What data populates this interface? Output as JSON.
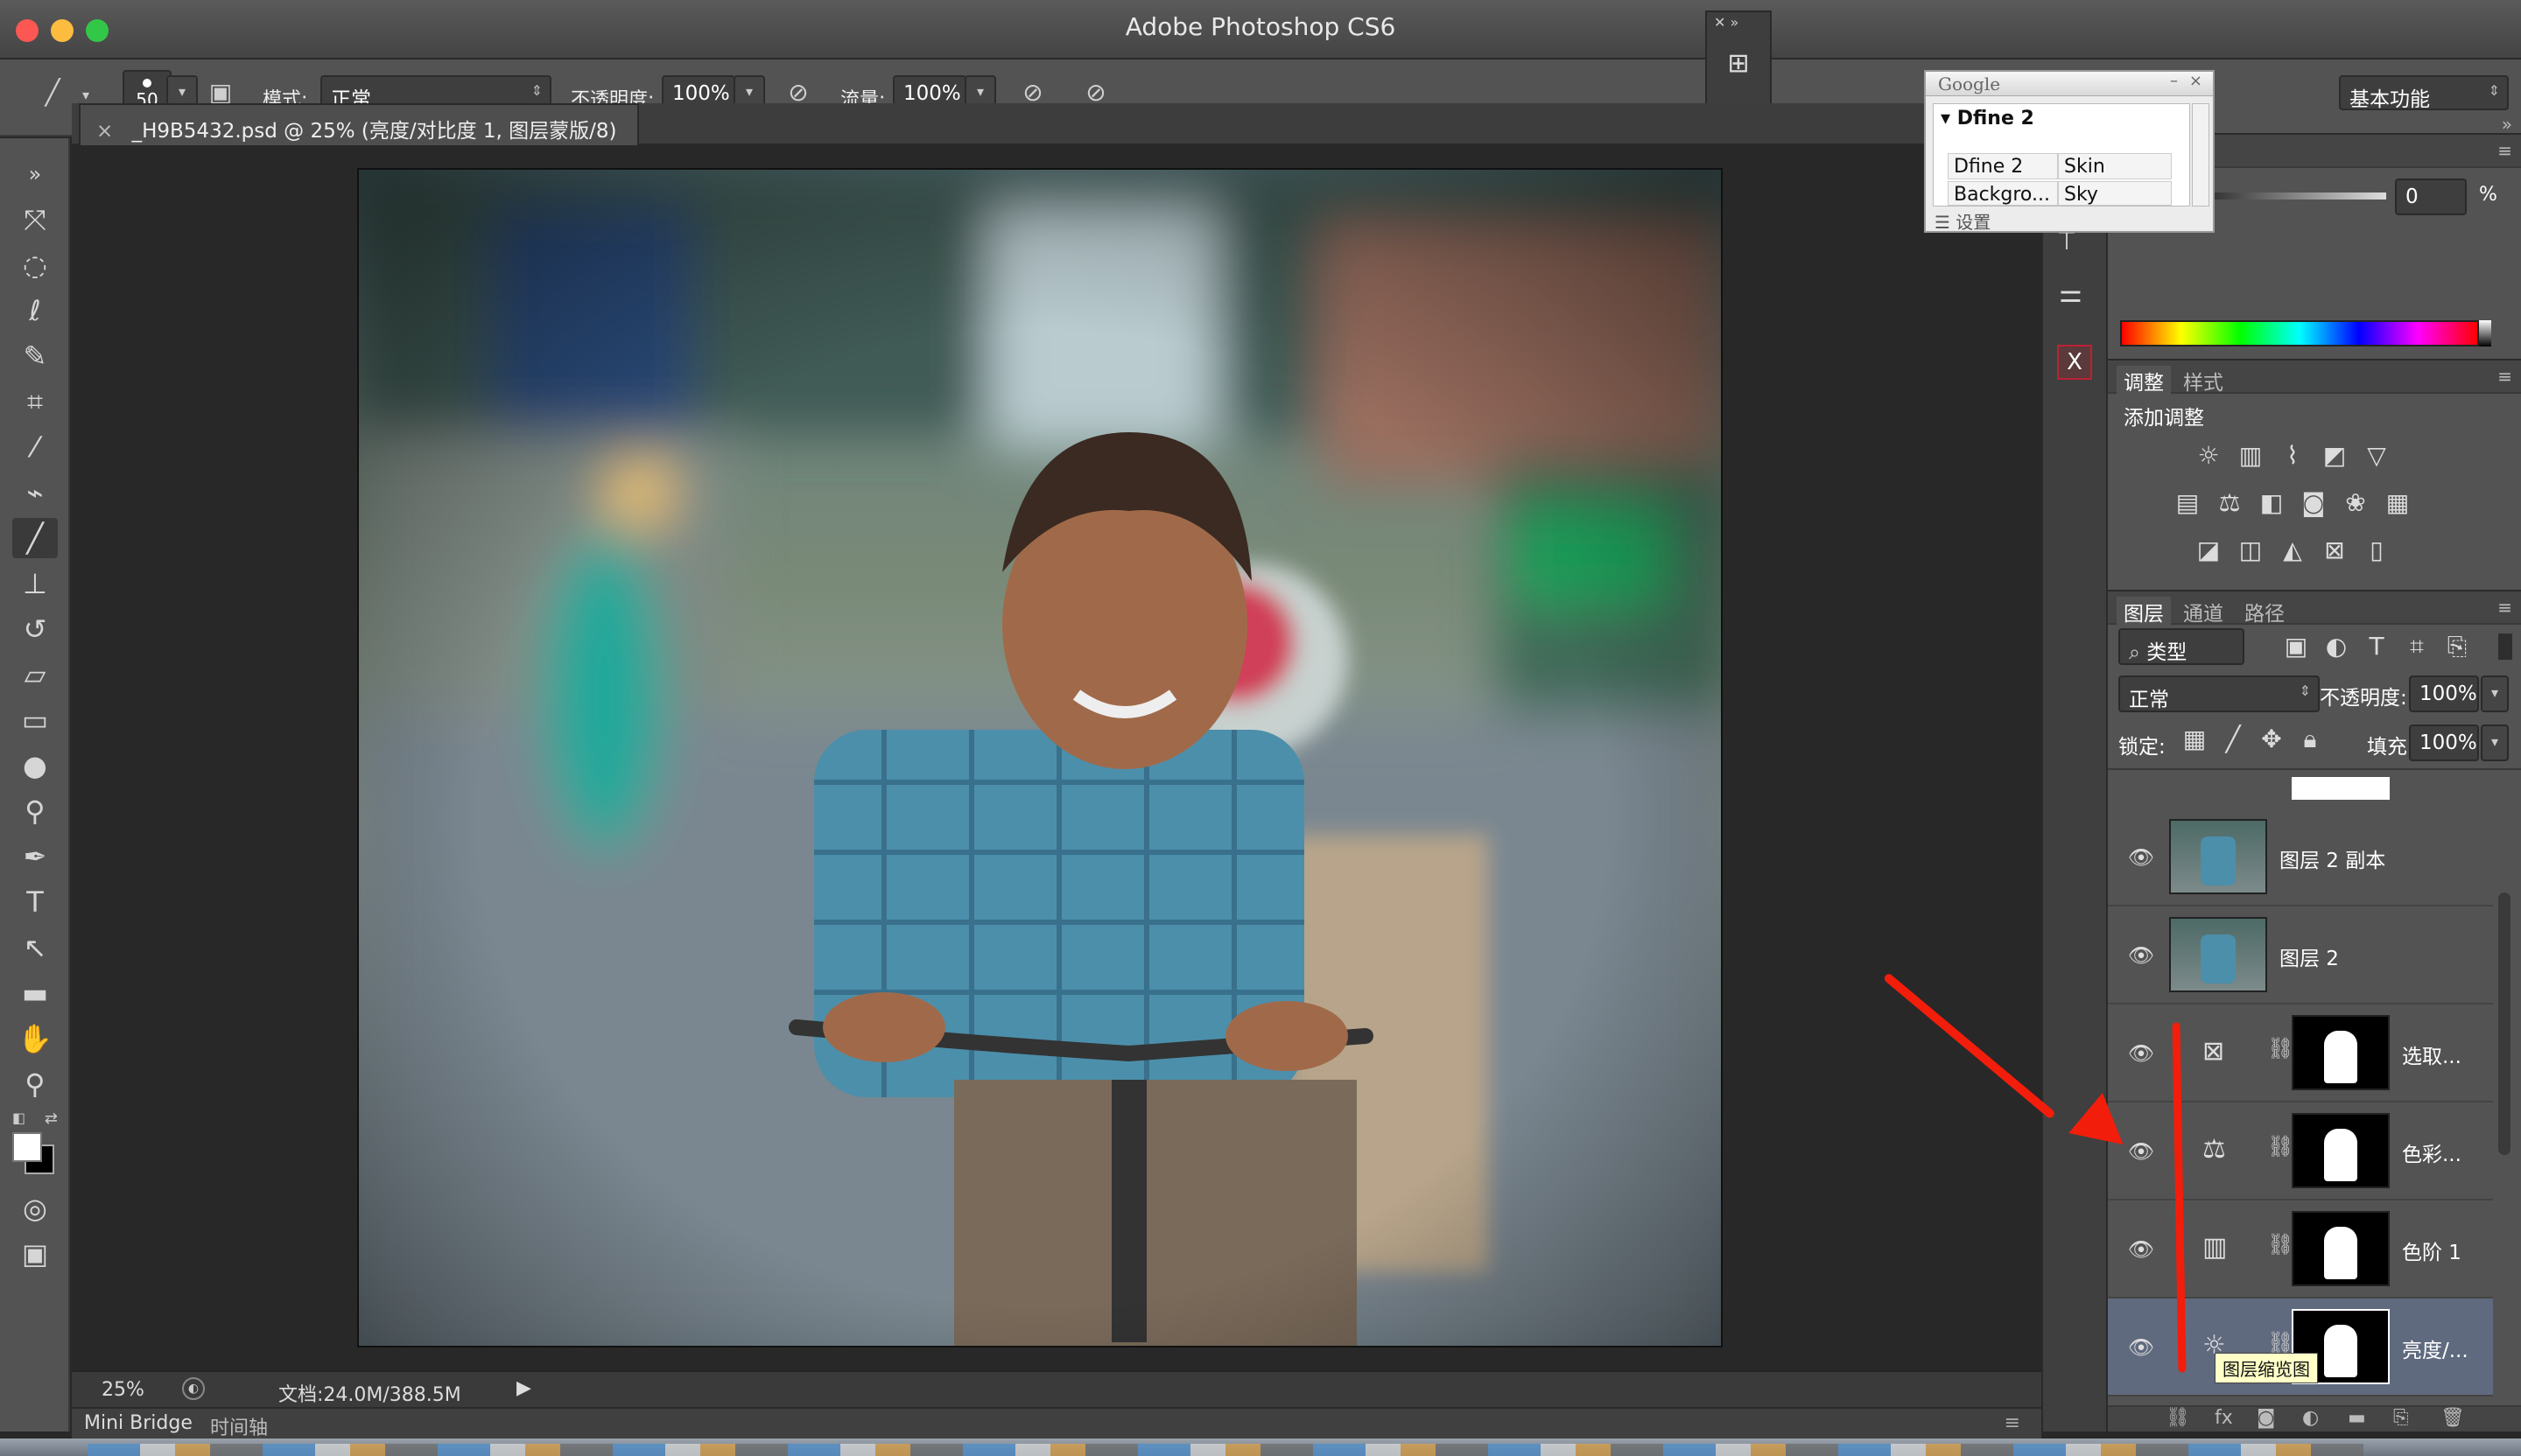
{
  "window": {
    "title": "Adobe Photoshop CS6",
    "corner_label": "Adobe Photoshop CS6"
  },
  "options_bar": {
    "brush_size": "50",
    "mode_label": "模式:",
    "mode_value": "正常",
    "opacity_label": "不透明度:",
    "opacity_value": "100%",
    "flow_label": "流量:",
    "flow_value": "100%",
    "workspace": "基本功能"
  },
  "document": {
    "tab_close": "×",
    "tab_title": "_H9B5432.psd @ 25% (亮度/对比度 1, 图层蒙版/8) *"
  },
  "status_bar": {
    "zoom": "25%",
    "doc_info": "文档:24.0M/388.5M"
  },
  "bridge_tabs": [
    "Mini Bridge",
    "时间轴"
  ],
  "google_panel": {
    "title": "Google",
    "header": "Dfine 2",
    "rows": [
      [
        "Dfine 2",
        "Skin"
      ],
      [
        "Backgro...",
        "Sky"
      ]
    ],
    "settings": "设置"
  },
  "color_panel": {
    "value": "0",
    "unit": "%"
  },
  "adjust_panel": {
    "tabs": [
      "调整",
      "样式"
    ],
    "title": "添加调整"
  },
  "layers_panel": {
    "tabs": [
      "图层",
      "通道",
      "路径"
    ],
    "filter_type": "类型",
    "blend_mode": "正常",
    "opacity_label": "不透明度:",
    "opacity_value": "100%",
    "lock_label": "锁定:",
    "fill_label": "填充:",
    "fill_value": "100%",
    "layers": [
      {
        "name": "图层 2 副本"
      },
      {
        "name": "图层 2"
      },
      {
        "name": "选取..."
      },
      {
        "name": "色彩..."
      },
      {
        "name": "色阶 1"
      },
      {
        "name": "亮度/..."
      }
    ],
    "tooltip": "图层缩览图"
  },
  "colors": {
    "accent_red": "#f31d0b",
    "selected_layer": "#5f6a7f"
  }
}
